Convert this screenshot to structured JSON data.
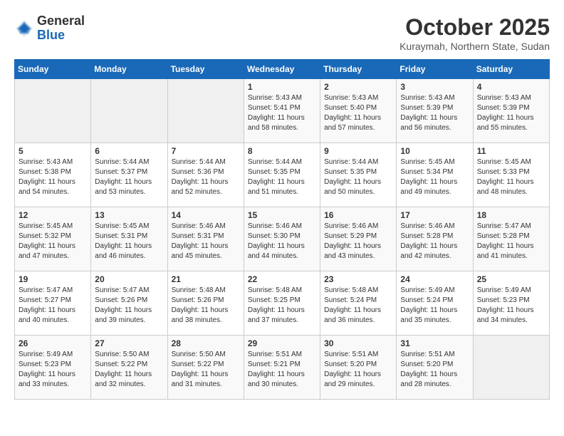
{
  "logo": {
    "text_general": "General",
    "text_blue": "Blue"
  },
  "title": "October 2025",
  "location": "Kuraymah, Northern State, Sudan",
  "days_header": [
    "Sunday",
    "Monday",
    "Tuesday",
    "Wednesday",
    "Thursday",
    "Friday",
    "Saturday"
  ],
  "weeks": [
    [
      {
        "day": "",
        "info": ""
      },
      {
        "day": "",
        "info": ""
      },
      {
        "day": "",
        "info": ""
      },
      {
        "day": "1",
        "info": "Sunrise: 5:43 AM\nSunset: 5:41 PM\nDaylight: 11 hours\nand 58 minutes."
      },
      {
        "day": "2",
        "info": "Sunrise: 5:43 AM\nSunset: 5:40 PM\nDaylight: 11 hours\nand 57 minutes."
      },
      {
        "day": "3",
        "info": "Sunrise: 5:43 AM\nSunset: 5:39 PM\nDaylight: 11 hours\nand 56 minutes."
      },
      {
        "day": "4",
        "info": "Sunrise: 5:43 AM\nSunset: 5:39 PM\nDaylight: 11 hours\nand 55 minutes."
      }
    ],
    [
      {
        "day": "5",
        "info": "Sunrise: 5:43 AM\nSunset: 5:38 PM\nDaylight: 11 hours\nand 54 minutes."
      },
      {
        "day": "6",
        "info": "Sunrise: 5:44 AM\nSunset: 5:37 PM\nDaylight: 11 hours\nand 53 minutes."
      },
      {
        "day": "7",
        "info": "Sunrise: 5:44 AM\nSunset: 5:36 PM\nDaylight: 11 hours\nand 52 minutes."
      },
      {
        "day": "8",
        "info": "Sunrise: 5:44 AM\nSunset: 5:35 PM\nDaylight: 11 hours\nand 51 minutes."
      },
      {
        "day": "9",
        "info": "Sunrise: 5:44 AM\nSunset: 5:35 PM\nDaylight: 11 hours\nand 50 minutes."
      },
      {
        "day": "10",
        "info": "Sunrise: 5:45 AM\nSunset: 5:34 PM\nDaylight: 11 hours\nand 49 minutes."
      },
      {
        "day": "11",
        "info": "Sunrise: 5:45 AM\nSunset: 5:33 PM\nDaylight: 11 hours\nand 48 minutes."
      }
    ],
    [
      {
        "day": "12",
        "info": "Sunrise: 5:45 AM\nSunset: 5:32 PM\nDaylight: 11 hours\nand 47 minutes."
      },
      {
        "day": "13",
        "info": "Sunrise: 5:45 AM\nSunset: 5:31 PM\nDaylight: 11 hours\nand 46 minutes."
      },
      {
        "day": "14",
        "info": "Sunrise: 5:46 AM\nSunset: 5:31 PM\nDaylight: 11 hours\nand 45 minutes."
      },
      {
        "day": "15",
        "info": "Sunrise: 5:46 AM\nSunset: 5:30 PM\nDaylight: 11 hours\nand 44 minutes."
      },
      {
        "day": "16",
        "info": "Sunrise: 5:46 AM\nSunset: 5:29 PM\nDaylight: 11 hours\nand 43 minutes."
      },
      {
        "day": "17",
        "info": "Sunrise: 5:46 AM\nSunset: 5:28 PM\nDaylight: 11 hours\nand 42 minutes."
      },
      {
        "day": "18",
        "info": "Sunrise: 5:47 AM\nSunset: 5:28 PM\nDaylight: 11 hours\nand 41 minutes."
      }
    ],
    [
      {
        "day": "19",
        "info": "Sunrise: 5:47 AM\nSunset: 5:27 PM\nDaylight: 11 hours\nand 40 minutes."
      },
      {
        "day": "20",
        "info": "Sunrise: 5:47 AM\nSunset: 5:26 PM\nDaylight: 11 hours\nand 39 minutes."
      },
      {
        "day": "21",
        "info": "Sunrise: 5:48 AM\nSunset: 5:26 PM\nDaylight: 11 hours\nand 38 minutes."
      },
      {
        "day": "22",
        "info": "Sunrise: 5:48 AM\nSunset: 5:25 PM\nDaylight: 11 hours\nand 37 minutes."
      },
      {
        "day": "23",
        "info": "Sunrise: 5:48 AM\nSunset: 5:24 PM\nDaylight: 11 hours\nand 36 minutes."
      },
      {
        "day": "24",
        "info": "Sunrise: 5:49 AM\nSunset: 5:24 PM\nDaylight: 11 hours\nand 35 minutes."
      },
      {
        "day": "25",
        "info": "Sunrise: 5:49 AM\nSunset: 5:23 PM\nDaylight: 11 hours\nand 34 minutes."
      }
    ],
    [
      {
        "day": "26",
        "info": "Sunrise: 5:49 AM\nSunset: 5:23 PM\nDaylight: 11 hours\nand 33 minutes."
      },
      {
        "day": "27",
        "info": "Sunrise: 5:50 AM\nSunset: 5:22 PM\nDaylight: 11 hours\nand 32 minutes."
      },
      {
        "day": "28",
        "info": "Sunrise: 5:50 AM\nSunset: 5:22 PM\nDaylight: 11 hours\nand 31 minutes."
      },
      {
        "day": "29",
        "info": "Sunrise: 5:51 AM\nSunset: 5:21 PM\nDaylight: 11 hours\nand 30 minutes."
      },
      {
        "day": "30",
        "info": "Sunrise: 5:51 AM\nSunset: 5:20 PM\nDaylight: 11 hours\nand 29 minutes."
      },
      {
        "day": "31",
        "info": "Sunrise: 5:51 AM\nSunset: 5:20 PM\nDaylight: 11 hours\nand 28 minutes."
      },
      {
        "day": "",
        "info": ""
      }
    ]
  ]
}
